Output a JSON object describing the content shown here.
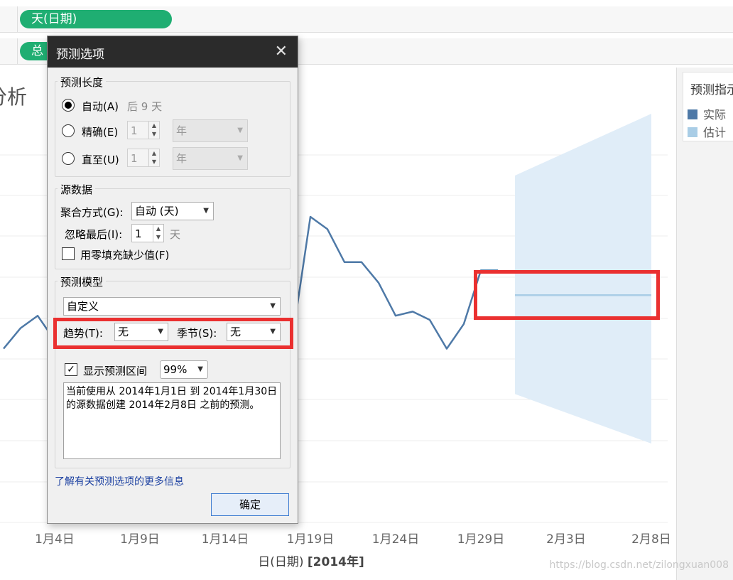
{
  "shelves": {
    "columns_pill": "天(日期)",
    "rows_pill": "总"
  },
  "worksheet": {
    "title_fragment": "分析"
  },
  "legend": {
    "title": "预测指示",
    "items": [
      {
        "label": "实际",
        "color": "#4e79a7"
      },
      {
        "label": "估计",
        "color": "#a9cde6"
      }
    ]
  },
  "chart_data": {
    "type": "line",
    "x_tick_labels": [
      "1月4日",
      "1月9日",
      "1月14日",
      "1月19日",
      "1月24日",
      "1月29日",
      "2月3日",
      "2月8日"
    ],
    "xlabel_prefix": "日(日期)",
    "xlabel_year": "[2014年]",
    "series": [
      {
        "name": "实际",
        "color": "#4e79a7",
        "x": [
          "1月1日",
          "1月2日",
          "1月3日",
          "1月4日",
          "1月5日",
          "1月18日",
          "1月19日",
          "1月20日",
          "1月21日",
          "1月22日",
          "1月23日",
          "1月24日",
          "1月25日",
          "1月26日",
          "1月27日",
          "1月28日",
          "1月29日",
          "1月30日"
        ],
        "values": [
          0.43,
          0.48,
          0.51,
          0.45,
          0.43,
          0.47,
          0.75,
          0.72,
          0.64,
          0.64,
          0.59,
          0.51,
          0.52,
          0.5,
          0.43,
          0.49,
          0.62,
          0.62
        ]
      },
      {
        "name": "估计",
        "color": "#a9cde6",
        "x": [
          "1月31日",
          "2月8日"
        ],
        "values": [
          0.56,
          0.56
        ],
        "interval_upper": [
          0.85,
          1.0
        ],
        "interval_lower": [
          0.32,
          0.2
        ]
      }
    ]
  },
  "dialog": {
    "title": "预测选项",
    "close_glyph": "✕",
    "forecast_length": {
      "group_label": "预测长度",
      "auto_label": "自动(A)",
      "auto_hint": "后 9 天",
      "exact_label": "精确(E)",
      "exact_value": "1",
      "exact_unit": "年",
      "until_label": "直至(U)",
      "until_value": "1",
      "until_unit": "年"
    },
    "source_data": {
      "group_label": "源数据",
      "aggregate_label": "聚合方式(G):",
      "aggregate_value": "自动 (天)",
      "ignore_label": "忽略最后(I):",
      "ignore_value": "1",
      "ignore_unit": "天",
      "fill_zero_label": "用零填充缺少值(F)"
    },
    "model": {
      "group_label": "预测模型",
      "model_value": "自定义",
      "trend_label": "趋势(T):",
      "trend_value": "无",
      "season_label": "季节(S):",
      "season_value": "无",
      "show_interval_label": "显示预测区间",
      "interval_value": "99%",
      "description": "当前使用从 2014年1月1日 到 2014年1月30日 的源数据创建 2014年2月8日 之前的预测。"
    },
    "more_info_link": "了解有关预测选项的更多信息",
    "ok_label": "确定"
  },
  "watermark": "https://blog.csdn.net/zilongxuan008",
  "colors": {
    "highlight": "#ea3030",
    "pill": "#1fae72",
    "title_bar": "#2b2b2b"
  }
}
